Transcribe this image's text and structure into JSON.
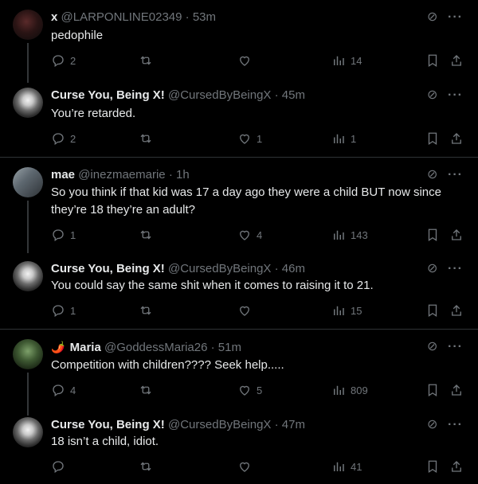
{
  "tweets": [
    {
      "name": "x",
      "handle": "@LARPONLINE02349",
      "dot": "·",
      "time": "53m",
      "text": "pedophile",
      "replies": "2",
      "retweets": "",
      "likes": "",
      "views": "14",
      "emoji": ""
    },
    {
      "name": "Curse You, Being X!",
      "handle": "@CursedByBeingX",
      "dot": "·",
      "time": "45m",
      "text": "You’re retarded.",
      "replies": "2",
      "retweets": "",
      "likes": "1",
      "views": "1",
      "emoji": ""
    },
    {
      "name": "mae",
      "handle": "@inezmaemarie",
      "dot": "·",
      "time": "1h",
      "text": "So you think if that kid was 17 a day ago they were a child BUT now since they’re 18 they’re an adult?",
      "replies": "1",
      "retweets": "",
      "likes": "4",
      "views": "143",
      "emoji": ""
    },
    {
      "name": "Curse You, Being X!",
      "handle": "@CursedByBeingX",
      "dot": "·",
      "time": "46m",
      "text": "You could say the same shit when it comes to raising it to 21.",
      "replies": "1",
      "retweets": "",
      "likes": "",
      "views": "15",
      "emoji": ""
    },
    {
      "name": "Maria",
      "handle": "@GoddessMaria26",
      "dot": "·",
      "time": "51m",
      "text": "Competition with children???? Seek help.....",
      "replies": "4",
      "retweets": "",
      "likes": "5",
      "views": "809",
      "emoji": "🌶️"
    },
    {
      "name": "Curse You, Being X!",
      "handle": "@CursedByBeingX",
      "dot": "·",
      "time": "47m",
      "text": "18 isn’t a child, idiot.",
      "replies": "",
      "retweets": "",
      "likes": "",
      "views": "41",
      "emoji": ""
    }
  ],
  "icons": {
    "grok": "grok-icon",
    "more": "more-icon",
    "reply": "reply-icon",
    "retweet": "retweet-icon",
    "like": "heart-icon",
    "views": "views-icon",
    "bookmark": "bookmark-icon",
    "share": "share-icon"
  },
  "colors": {
    "background": "#000000",
    "text": "#e7e9ea",
    "muted": "#71767b",
    "divider": "#2f3336",
    "thread": "#333639"
  }
}
